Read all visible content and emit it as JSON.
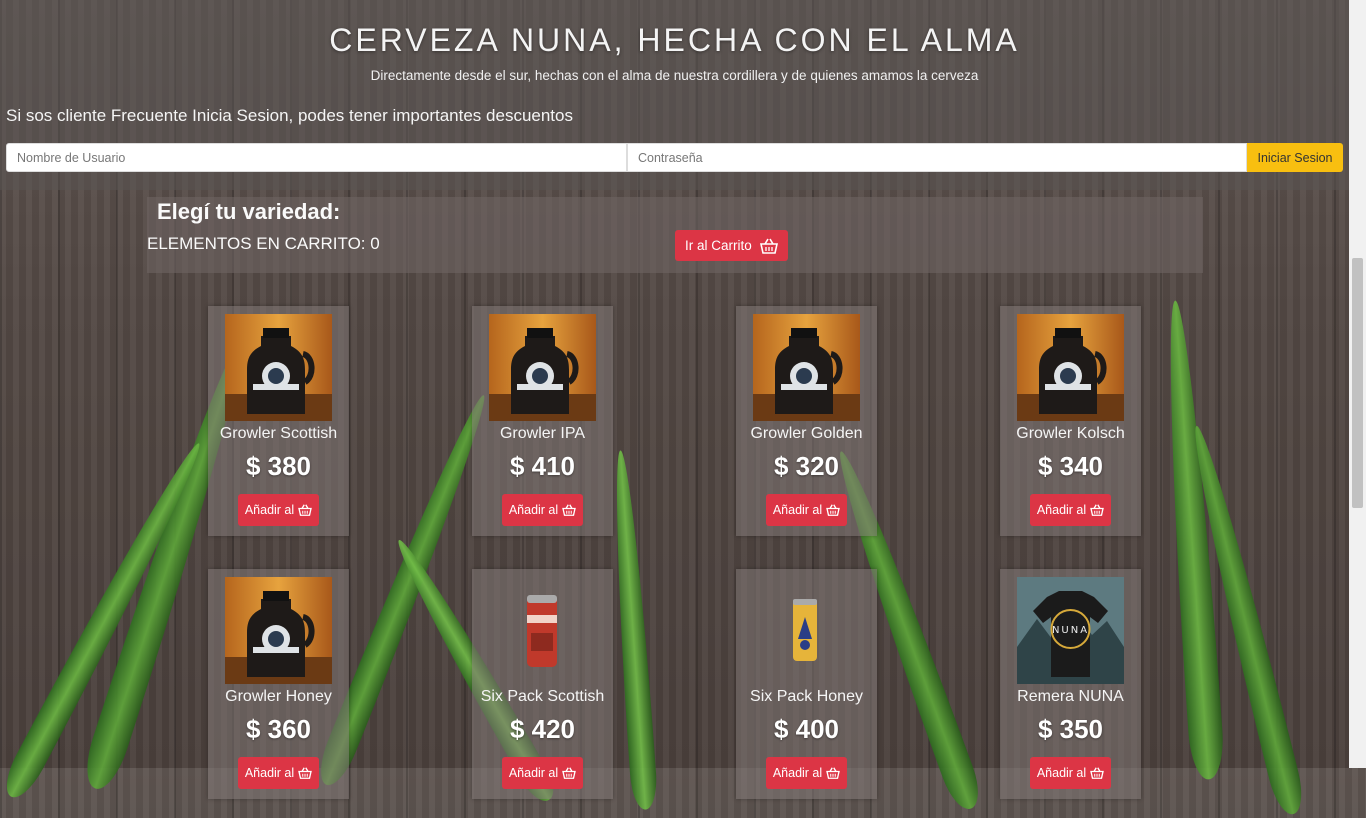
{
  "header": {
    "title": "CERVEZA NUNA, HECHA CON EL ALMA",
    "subtitle": "Directamente desde el sur, hechas con el alma de nuestra cordillera y de quienes amamos la cerveza"
  },
  "login": {
    "message": "Si sos cliente Frecuente Inicia Sesion, podes tener importantes descuentos",
    "username_placeholder": "Nombre de Usuario",
    "password_placeholder": "Contraseña",
    "submit_label": "Iniciar Sesion"
  },
  "cart": {
    "heading": "Elegí tu variedad:",
    "count_text": "ELEMENTOS EN CARRITO: 0",
    "go_label": "Ir al Carrito",
    "icon": "basket-icon"
  },
  "products": [
    {
      "name": "Growler Scottish",
      "price": "$ 380",
      "add_label": "Añadir al",
      "image": "growler"
    },
    {
      "name": "Growler IPA",
      "price": "$ 410",
      "add_label": "Añadir al",
      "image": "growler"
    },
    {
      "name": "Growler Golden",
      "price": "$ 320",
      "add_label": "Añadir al",
      "image": "growler"
    },
    {
      "name": "Growler Kolsch",
      "price": "$ 340",
      "add_label": "Añadir al",
      "image": "growler"
    },
    {
      "name": "Growler Honey",
      "price": "$ 360",
      "add_label": "Añadir al",
      "image": "growler"
    },
    {
      "name": "Six Pack Scottish",
      "price": "$ 420",
      "add_label": "Añadir al",
      "image": "red-can"
    },
    {
      "name": "Six Pack Honey",
      "price": "$ 400",
      "add_label": "Añadir al",
      "image": "gold-can"
    },
    {
      "name": "Remera NUNA",
      "price": "$ 350",
      "add_label": "Añadir al",
      "image": "tshirt",
      "shirt_text": "NUNA"
    }
  ],
  "colors": {
    "accent_red": "#dc3545",
    "login_yellow": "#f8bf10"
  }
}
